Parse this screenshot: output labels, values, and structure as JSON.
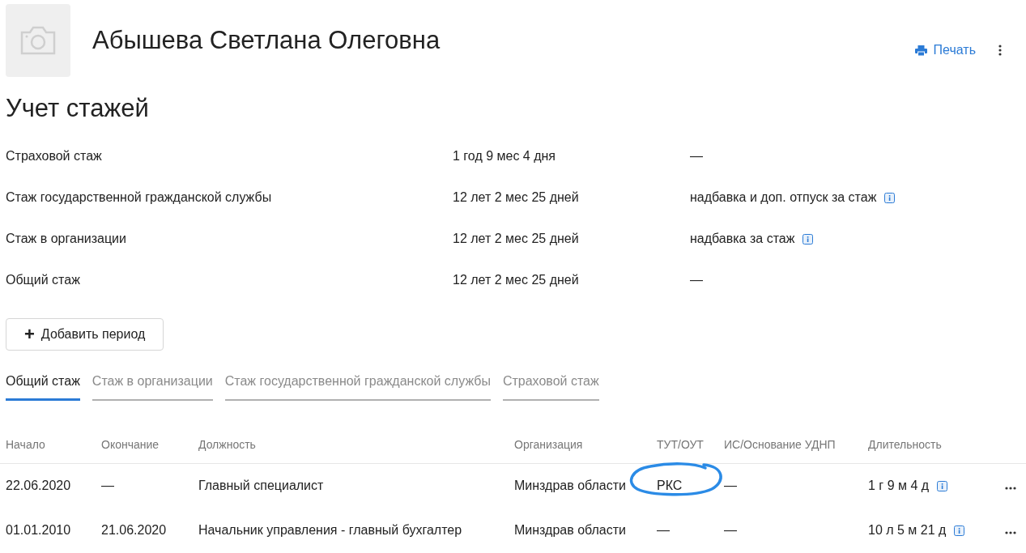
{
  "person": {
    "name": "Абышева Светлана Олеговна"
  },
  "toolbar": {
    "print": "Печать"
  },
  "title": "Учет стажей",
  "summary": [
    {
      "label": "Страховой стаж",
      "value": "1 год 9 мес 4 дня",
      "note": "—",
      "info": false
    },
    {
      "label": "Стаж государственной гражданской службы",
      "value": "12 лет 2 мес 25 дней",
      "note": "надбавка и доп. отпуск за стаж",
      "info": true
    },
    {
      "label": "Стаж в организации",
      "value": "12 лет 2 мес 25 дней",
      "note": "надбавка за стаж",
      "info": true
    },
    {
      "label": "Общий стаж",
      "value": "12 лет 2 мес 25 дней",
      "note": "—",
      "info": false
    }
  ],
  "add_button": {
    "icon": "+",
    "label": "Добавить период"
  },
  "tabs": [
    {
      "label": "Общий стаж",
      "selected": true
    },
    {
      "label": "Стаж в организации",
      "selected": false
    },
    {
      "label": "Стаж государственной гражданской службы",
      "selected": false
    },
    {
      "label": "Страховой стаж",
      "selected": false
    }
  ],
  "table": {
    "columns": [
      "Начало",
      "Окончание",
      "Должность",
      "Организация",
      "ТУТ/ОУТ",
      "ИС/Основание УДНП",
      "Длительность"
    ],
    "rows": [
      {
        "cells": [
          "22.06.2020",
          "—",
          "Главный специалист",
          "Минздрав области",
          "РКС",
          "—",
          "1 г 9 м 4 д"
        ],
        "circled": true
      },
      {
        "cells": [
          "01.01.2010",
          "21.06.2020",
          "Начальник управления - главный бухгалтер",
          "Минздрав области",
          "—",
          "—",
          "10 л 5 м 21 д"
        ],
        "circled": false
      }
    ]
  }
}
